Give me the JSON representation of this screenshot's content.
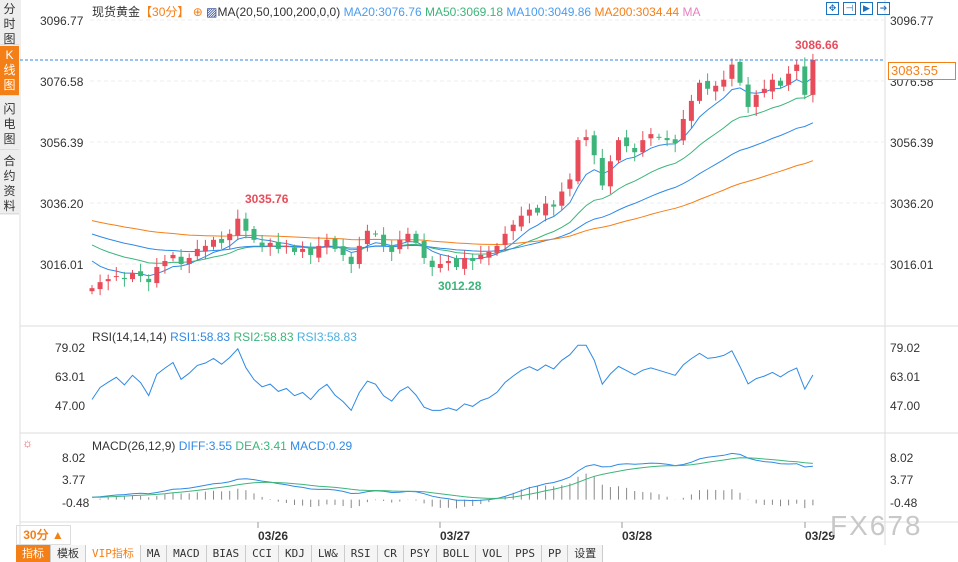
{
  "sidebar": {
    "tabs": [
      {
        "label": "分时图"
      },
      {
        "label": "K线图",
        "active": true
      },
      {
        "label": "闪电图"
      },
      {
        "label": "合约资料"
      }
    ]
  },
  "header": {
    "symbol": "现货黄金",
    "period": "【30分】",
    "ma_label": "MA(20,50,100,200,0,0)",
    "ma20": "MA20:3076.76",
    "ma50": "MA50:3069.18",
    "ma100": "MA100:3049.86",
    "ma200": "MA200:3034.44",
    "ma_extra": "MA"
  },
  "toolbar_icons": [
    "crosshair-icon",
    "zoom-range-icon",
    "play-range-icon",
    "exit-icon"
  ],
  "price_axis": [
    "3096.77",
    "3076.58",
    "3056.39",
    "3036.20",
    "3016.01"
  ],
  "last_price": "3083.55",
  "annotations": {
    "high": "3086.66",
    "mid_high": "3035.76",
    "low": "3012.28"
  },
  "rsi": {
    "label": "RSI(14,14,14)",
    "rsi1": "RSI1:58.83",
    "rsi2": "RSI2:58.83",
    "rsi3": "RSI3:58.83",
    "axis": [
      "79.02",
      "63.01",
      "47.00"
    ]
  },
  "macd": {
    "label": "MACD(26,12,9)",
    "diff": "DIFF:3.55",
    "dea": "DEA:3.41",
    "macd": "MACD:0.29",
    "axis": [
      "8.02",
      "3.77",
      "-0.48"
    ]
  },
  "x_axis": [
    "03/26",
    "03/27",
    "03/28",
    "03/29"
  ],
  "period_button": "30分 ▲",
  "bottom_tabs": [
    "指标",
    "模板",
    "VIP指标",
    "MA",
    "MACD",
    "BIAS",
    "CCI",
    "KDJ",
    "LW&",
    "RSI",
    "CR",
    "PSY",
    "BOLL",
    "VOL",
    "PPS",
    "PP",
    "设置"
  ],
  "watermark": "FX678",
  "colors": {
    "up": "#e84c5a",
    "down": "#3db57a",
    "ma20": "#2f8ae5",
    "ma50": "#3db57a",
    "ma100": "#2f8ae5",
    "ma200": "#f57f17",
    "accent": "#f57f17"
  },
  "chart_data": {
    "type": "candlestick",
    "ylim": [
      3000,
      3100
    ],
    "closes": [
      3008,
      3010,
      3011,
      3012,
      3011,
      3013,
      3012,
      3010,
      3015,
      3017,
      3019,
      3016,
      3018,
      3021,
      3022,
      3024,
      3023,
      3026,
      3031,
      3027,
      3024,
      3022,
      3023,
      3021,
      3022,
      3020,
      3021,
      3019,
      3022,
      3024,
      3021,
      3019,
      3016,
      3022,
      3027,
      3026,
      3022,
      3020,
      3024,
      3026,
      3023,
      3018,
      3015,
      3016,
      3017,
      3015,
      3018,
      3017,
      3019,
      3020,
      3022,
      3026,
      3029,
      3032,
      3034,
      3033,
      3036,
      3035,
      3040,
      3044,
      3057,
      3058,
      3052,
      3042,
      3050,
      3057,
      3055,
      3053,
      3057,
      3059,
      3058,
      3057,
      3056,
      3064,
      3070,
      3076,
      3074,
      3075,
      3077,
      3082,
      3076,
      3068,
      3072,
      3074,
      3077,
      3075,
      3079,
      3082,
      3072,
      3083.55
    ]
  }
}
